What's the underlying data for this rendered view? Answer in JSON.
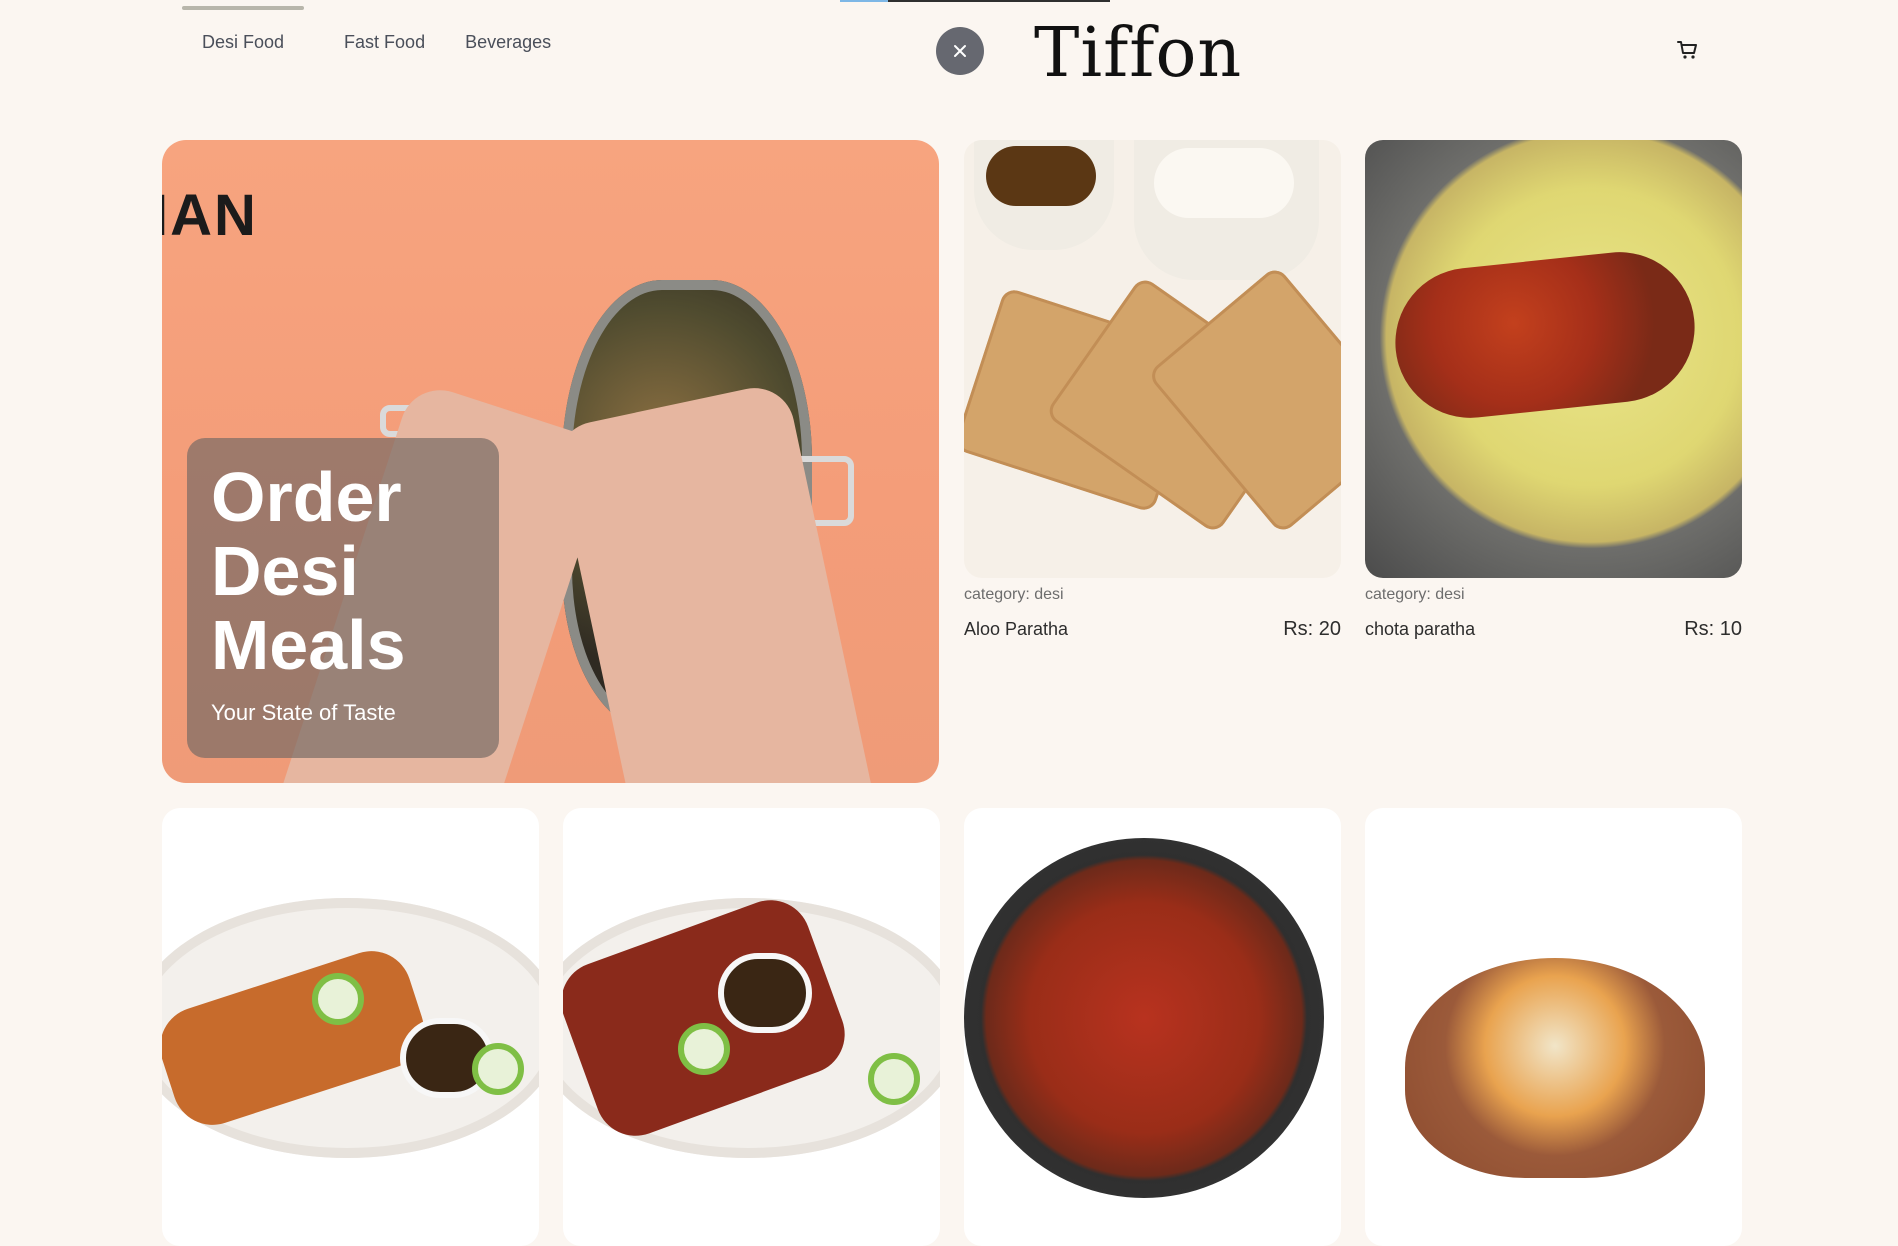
{
  "nav": {
    "items": [
      {
        "label": "Desi Food",
        "active": true
      },
      {
        "label": "Fast Food",
        "active": false
      },
      {
        "label": "Beverages",
        "active": false
      }
    ]
  },
  "header": {
    "brand": "Tiffon",
    "icons": {
      "close": "close-icon",
      "cart": "cart-icon"
    }
  },
  "hero": {
    "background_text": "IAN",
    "promo_title": "Order Desi Meals",
    "promo_subtitle": "Your State of Taste",
    "accent": "#f49d79"
  },
  "products": [
    {
      "name": "Aloo Paratha",
      "category": "category: desi",
      "price": "Rs: 20"
    },
    {
      "name": "chota paratha",
      "category": "category: desi",
      "price": "Rs: 10"
    }
  ],
  "colors": {
    "background": "#fbf6f1",
    "text": "#2d2d2d",
    "close_button": "#666870"
  }
}
